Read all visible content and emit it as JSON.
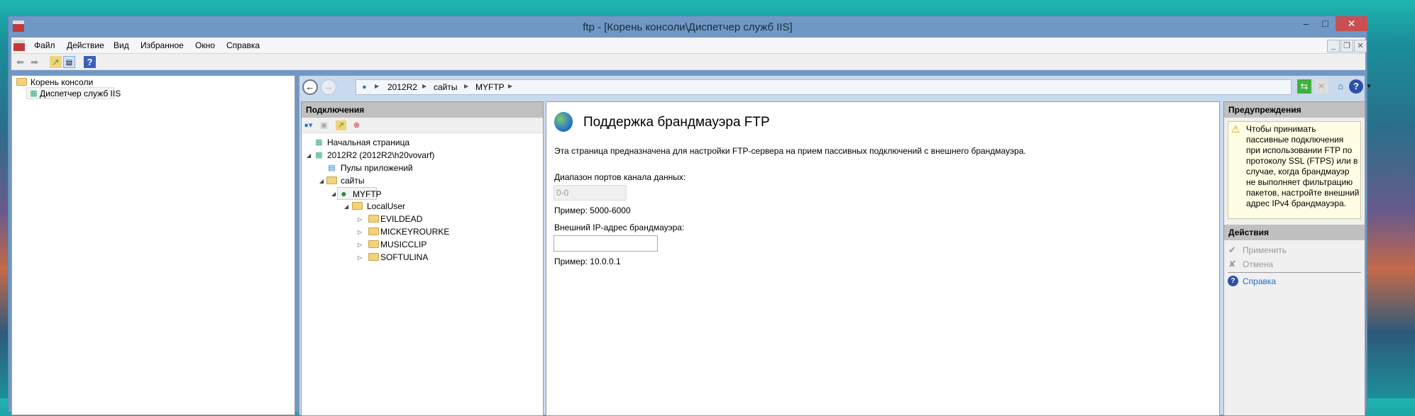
{
  "window": {
    "title": "ftp - [Корень консоли\\Диспетчер служб IIS]",
    "minimize": "–",
    "maximize": "□",
    "close": "✕"
  },
  "menu": [
    "Файл",
    "Действие",
    "Вид",
    "Избранное",
    "Окно",
    "Справка"
  ],
  "mdi": {
    "minimize": "_",
    "restore": "❐",
    "close": "✕"
  },
  "tree_left": {
    "root": "Корень консоли",
    "child": "Диспетчер служб IIS"
  },
  "breadcrumb": [
    "2012R2",
    "сайты",
    "MYFTP"
  ],
  "connections": {
    "title": "Подключения",
    "items": [
      "Начальная страница",
      "2012R2 (2012R2\\h20vovarf)",
      "Пулы приложений",
      "сайты",
      "MYFTP",
      "LocalUser",
      "EVILDEAD",
      "MICKEYROURKE",
      "MUSICCLIP",
      "SOFTULINA"
    ]
  },
  "content": {
    "title": "Поддержка брандмауэра FTP",
    "description": "Эта страница предназначена для настройки FTP-сервера на прием пассивных подключений с внешнего брандмауэра.",
    "port_label": "Диапазон портов канала данных:",
    "port_value": "0-0",
    "port_example": "Пример: 5000-6000",
    "ip_label": "Внешний IP-адрес брандмауэра:",
    "ip_value": "",
    "ip_example": "Пример: 10.0.0.1"
  },
  "alerts": {
    "title": "Предупреждения",
    "text": "Чтобы принимать пассивные подключения при использовании FTP по протоколу SSL (FTPS) или в случае, когда брандмауэр не выполняет фильтрацию пакетов, настройте внешний адрес IPv4 брандмауэра."
  },
  "actions": {
    "title": "Действия",
    "apply": "Применить",
    "cancel": "Отмена",
    "help": "Справка"
  },
  "colors": {
    "titlebar": "#6f98c5",
    "close": "#c75050",
    "link": "#1e6fbf"
  }
}
